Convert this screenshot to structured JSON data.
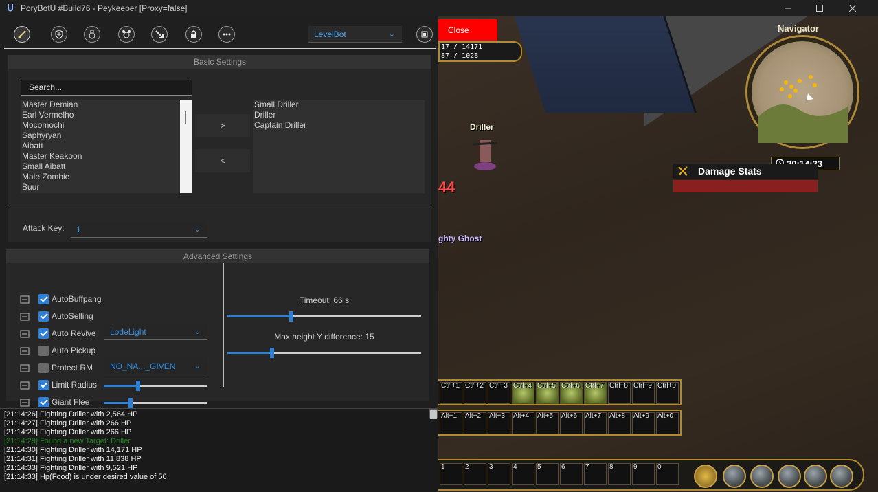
{
  "window": {
    "title": "PoryBotU #Build76 - Peykeeper  [Proxy=false]",
    "minimize_icon": "minimize-icon",
    "maximize_icon": "maximize-icon",
    "close_icon": "close-icon"
  },
  "toolbar": {
    "tools": [
      {
        "name": "sword-icon",
        "active": true
      },
      {
        "name": "shield-plus-icon",
        "active": false
      },
      {
        "name": "potion-icon",
        "active": false
      },
      {
        "name": "pet-icon",
        "active": false
      },
      {
        "name": "arrow-down-right-icon",
        "active": false
      },
      {
        "name": "lock-icon",
        "active": false
      },
      {
        "name": "more-icon",
        "active": false
      }
    ],
    "mode": "LevelBot",
    "cpu_icon": "cpu-icon"
  },
  "close_button": "Close",
  "basic_settings": {
    "header": "Basic Settings",
    "search_placeholder": "Search...",
    "mobs": [
      "Master Demian",
      "Earl Vermelho",
      "Mocomochi",
      "Saphyryan",
      "Aibatt",
      "Master Keakoon",
      "Small Aibatt",
      "Male Zombie",
      "Buur"
    ],
    "targets": [
      "Small Driller",
      "Driller",
      "Captain Driller"
    ],
    "add_label": ">",
    "remove_label": "<",
    "attack_key_label": "Attack Key:",
    "attack_key_value": "1"
  },
  "advanced_settings": {
    "header": "Advanced Settings",
    "rows": [
      {
        "label": "AutoBuffpang",
        "checked": true,
        "icon": "buff-icon"
      },
      {
        "label": "AutoSelling",
        "checked": true,
        "icon": "sell-icon"
      },
      {
        "label": "Auto Revive",
        "checked": true,
        "icon": "revive-icon",
        "dropdown": "LodeLight"
      },
      {
        "label": "Auto Pickup",
        "checked": false,
        "icon": "pickup-icon"
      },
      {
        "label": "Protect RM",
        "checked": false,
        "icon": "protect-icon",
        "dropdown": "NO_NA..._GIVEN"
      },
      {
        "label": "Limit Radius",
        "checked": true,
        "icon": "flag-icon",
        "slider": 0.33
      },
      {
        "label": "Giant Flee",
        "checked": true,
        "icon": "flag-icon",
        "slider": 0.26
      }
    ],
    "timeout_label": "Timeout: 66 s",
    "timeout_level": 0.33,
    "height_label": "Max height Y difference: 15",
    "height_level": 0.23
  },
  "log": [
    {
      "text": "[21:14:26] Fighting Driller with 2,564 HP",
      "found": false
    },
    {
      "text": "[21:14:27] Fighting Driller with 266 HP",
      "found": false
    },
    {
      "text": "[21:14:29] Fighting Driller with 266 HP",
      "found": false
    },
    {
      "text": "[21:14:29] Found a new Target: Driller",
      "found": true
    },
    {
      "text": "[21:14:30] Fighting Driller with 14,171 HP",
      "found": false
    },
    {
      "text": "[21:14:31] Fighting Driller with 11,838 HP",
      "found": false
    },
    {
      "text": "[21:14:33] Fighting Driller with 9,521 HP",
      "found": false
    },
    {
      "text": "[21:14:33] Hp(Food) is under desired value of 50",
      "found": false
    }
  ],
  "game": {
    "hp_text": "17 / 14171",
    "mp_text": "87 / 1028",
    "driller_label": "Driller",
    "ghost_label": "ghty Ghost",
    "damage_number": "44",
    "navigator_title": "Navigator",
    "navigator_time": "20:14:33",
    "damage_stats_title": "Damage Stats",
    "ctrl_keys": [
      "Ctrl+1",
      "Ctrl+2",
      "Ctrl+3",
      "Ctrl+4",
      "Ctrl+5",
      "Ctrl+6",
      "Ctrl+7",
      "Ctrl+8",
      "Ctrl+9",
      "Ctrl+0"
    ],
    "alt_keys": [
      "Alt+1",
      "Alt+2",
      "Alt+3",
      "Alt+4",
      "Alt+5",
      "Alt+6",
      "Alt+7",
      "Alt+8",
      "Alt+9",
      "Alt+0"
    ],
    "num_keys": [
      "1",
      "2",
      "3",
      "4",
      "5",
      "6",
      "7",
      "8",
      "9",
      "0"
    ]
  }
}
